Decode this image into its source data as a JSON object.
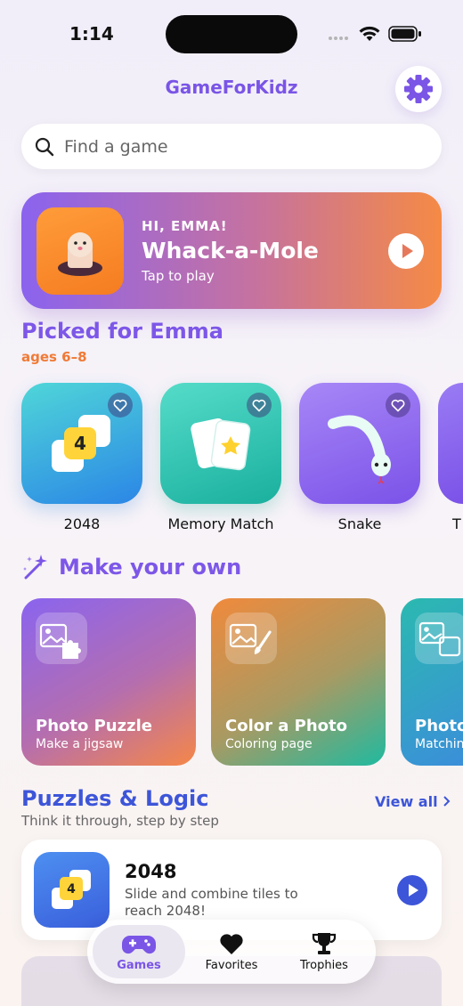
{
  "status": {
    "time": "1:14"
  },
  "header": {
    "title": "GameForKidz",
    "settings_icon": "gear-icon"
  },
  "search": {
    "placeholder": "Find a game"
  },
  "hero": {
    "greeting": "HI, EMMA!",
    "title": "Whack-a-Mole",
    "subtitle": "Tap to play"
  },
  "picked": {
    "title": "Picked for Emma",
    "subtitle": "ages 6–8",
    "games": [
      {
        "label": "2048"
      },
      {
        "label": "Memory Match"
      },
      {
        "label": "Snake"
      },
      {
        "label": "T"
      }
    ]
  },
  "make": {
    "title": "Make your own",
    "cards": [
      {
        "title": "Photo Puzzle",
        "subtitle": "Make a jigsaw"
      },
      {
        "title": "Color a Photo",
        "subtitle": "Coloring page"
      },
      {
        "title": "Photo",
        "subtitle": "Matchin"
      }
    ]
  },
  "puzzles": {
    "title": "Puzzles & Logic",
    "subtitle": "Think it through, step by step",
    "view_all": "View all",
    "item": {
      "title": "2048",
      "description": "Slide and combine tiles to reach 2048!",
      "tile_number": "4"
    }
  },
  "tile_2048_number": "4",
  "nav": {
    "games": "Games",
    "favorites": "Favorites",
    "trophies": "Trophies",
    "active": "games"
  },
  "colors": {
    "accent": "#7a55e6",
    "orange": "#f07a35",
    "blue": "#3d55d8"
  }
}
